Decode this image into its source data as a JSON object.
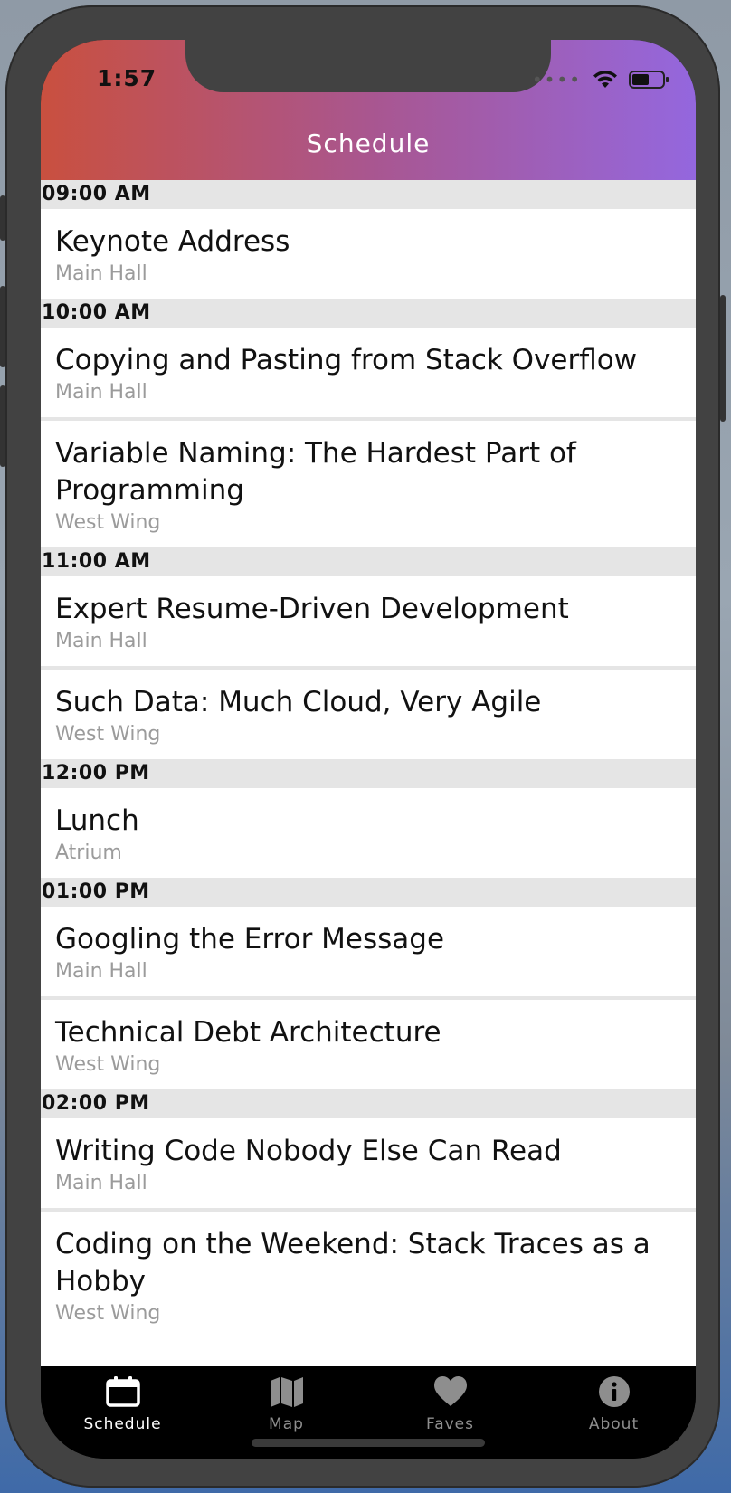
{
  "status_bar": {
    "time": "1:57"
  },
  "header": {
    "title": "Schedule"
  },
  "schedule": [
    {
      "time": "09:00 AM",
      "sessions": [
        {
          "title": "Keynote Address",
          "location": "Main Hall"
        }
      ]
    },
    {
      "time": "10:00 AM",
      "sessions": [
        {
          "title": "Copying and Pasting from Stack Overflow",
          "location": "Main Hall"
        },
        {
          "title": "Variable Naming: The Hardest Part of Programming",
          "location": "West Wing"
        }
      ]
    },
    {
      "time": "11:00 AM",
      "sessions": [
        {
          "title": "Expert Resume-Driven Development",
          "location": "Main Hall"
        },
        {
          "title": "Such Data: Much Cloud, Very Agile",
          "location": "West Wing"
        }
      ]
    },
    {
      "time": "12:00 PM",
      "sessions": [
        {
          "title": "Lunch",
          "location": "Atrium"
        }
      ]
    },
    {
      "time": "01:00 PM",
      "sessions": [
        {
          "title": "Googling the Error Message",
          "location": "Main Hall"
        },
        {
          "title": "Technical Debt Architecture",
          "location": "West Wing"
        }
      ]
    },
    {
      "time": "02:00 PM",
      "sessions": [
        {
          "title": "Writing Code Nobody Else Can Read",
          "location": "Main Hall"
        },
        {
          "title": "Coding on the Weekend: Stack Traces as a Hobby",
          "location": "West Wing"
        }
      ]
    }
  ],
  "tabbar": {
    "tabs": [
      {
        "label": "Schedule",
        "icon": "calendar-icon",
        "active": true
      },
      {
        "label": "Map",
        "icon": "map-icon",
        "active": false
      },
      {
        "label": "Faves",
        "icon": "heart-icon",
        "active": false
      },
      {
        "label": "About",
        "icon": "info-icon",
        "active": false
      }
    ]
  },
  "colors": {
    "header_gradient_start": "#c9503f",
    "header_gradient_end": "#9467de",
    "tab_active": "#ffffff",
    "tab_inactive": "#8e8e8e",
    "section_bg": "#e5e5e5",
    "subtitle": "#9b9b9b"
  }
}
